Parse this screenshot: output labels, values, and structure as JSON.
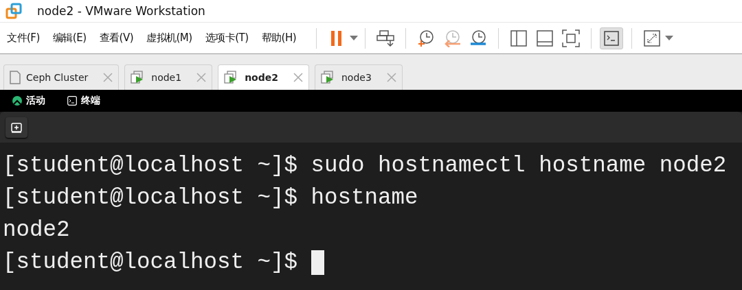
{
  "window": {
    "title": "node2 - VMware Workstation"
  },
  "menu": [
    "文件(F)",
    "编辑(E)",
    "查看(V)",
    "虚拟机(M)",
    "选项卡(T)",
    "帮助(H)"
  ],
  "toolbar": {
    "console_view_selected": true
  },
  "tabs": [
    {
      "label": "Ceph Cluster",
      "kind": "document",
      "selected": false
    },
    {
      "label": "node1",
      "kind": "vm",
      "selected": false
    },
    {
      "label": "node2",
      "kind": "vm",
      "selected": true
    },
    {
      "label": "node3",
      "kind": "vm",
      "selected": false
    }
  ],
  "top_bar": {
    "activities": "活动",
    "app": "终端"
  },
  "terminal": {
    "lines": [
      "[student@localhost ~]$ sudo hostnamectl hostname node2",
      "[student@localhost ~]$ hostname",
      "node2",
      "[student@localhost ~]$ "
    ],
    "cursor": true
  }
}
